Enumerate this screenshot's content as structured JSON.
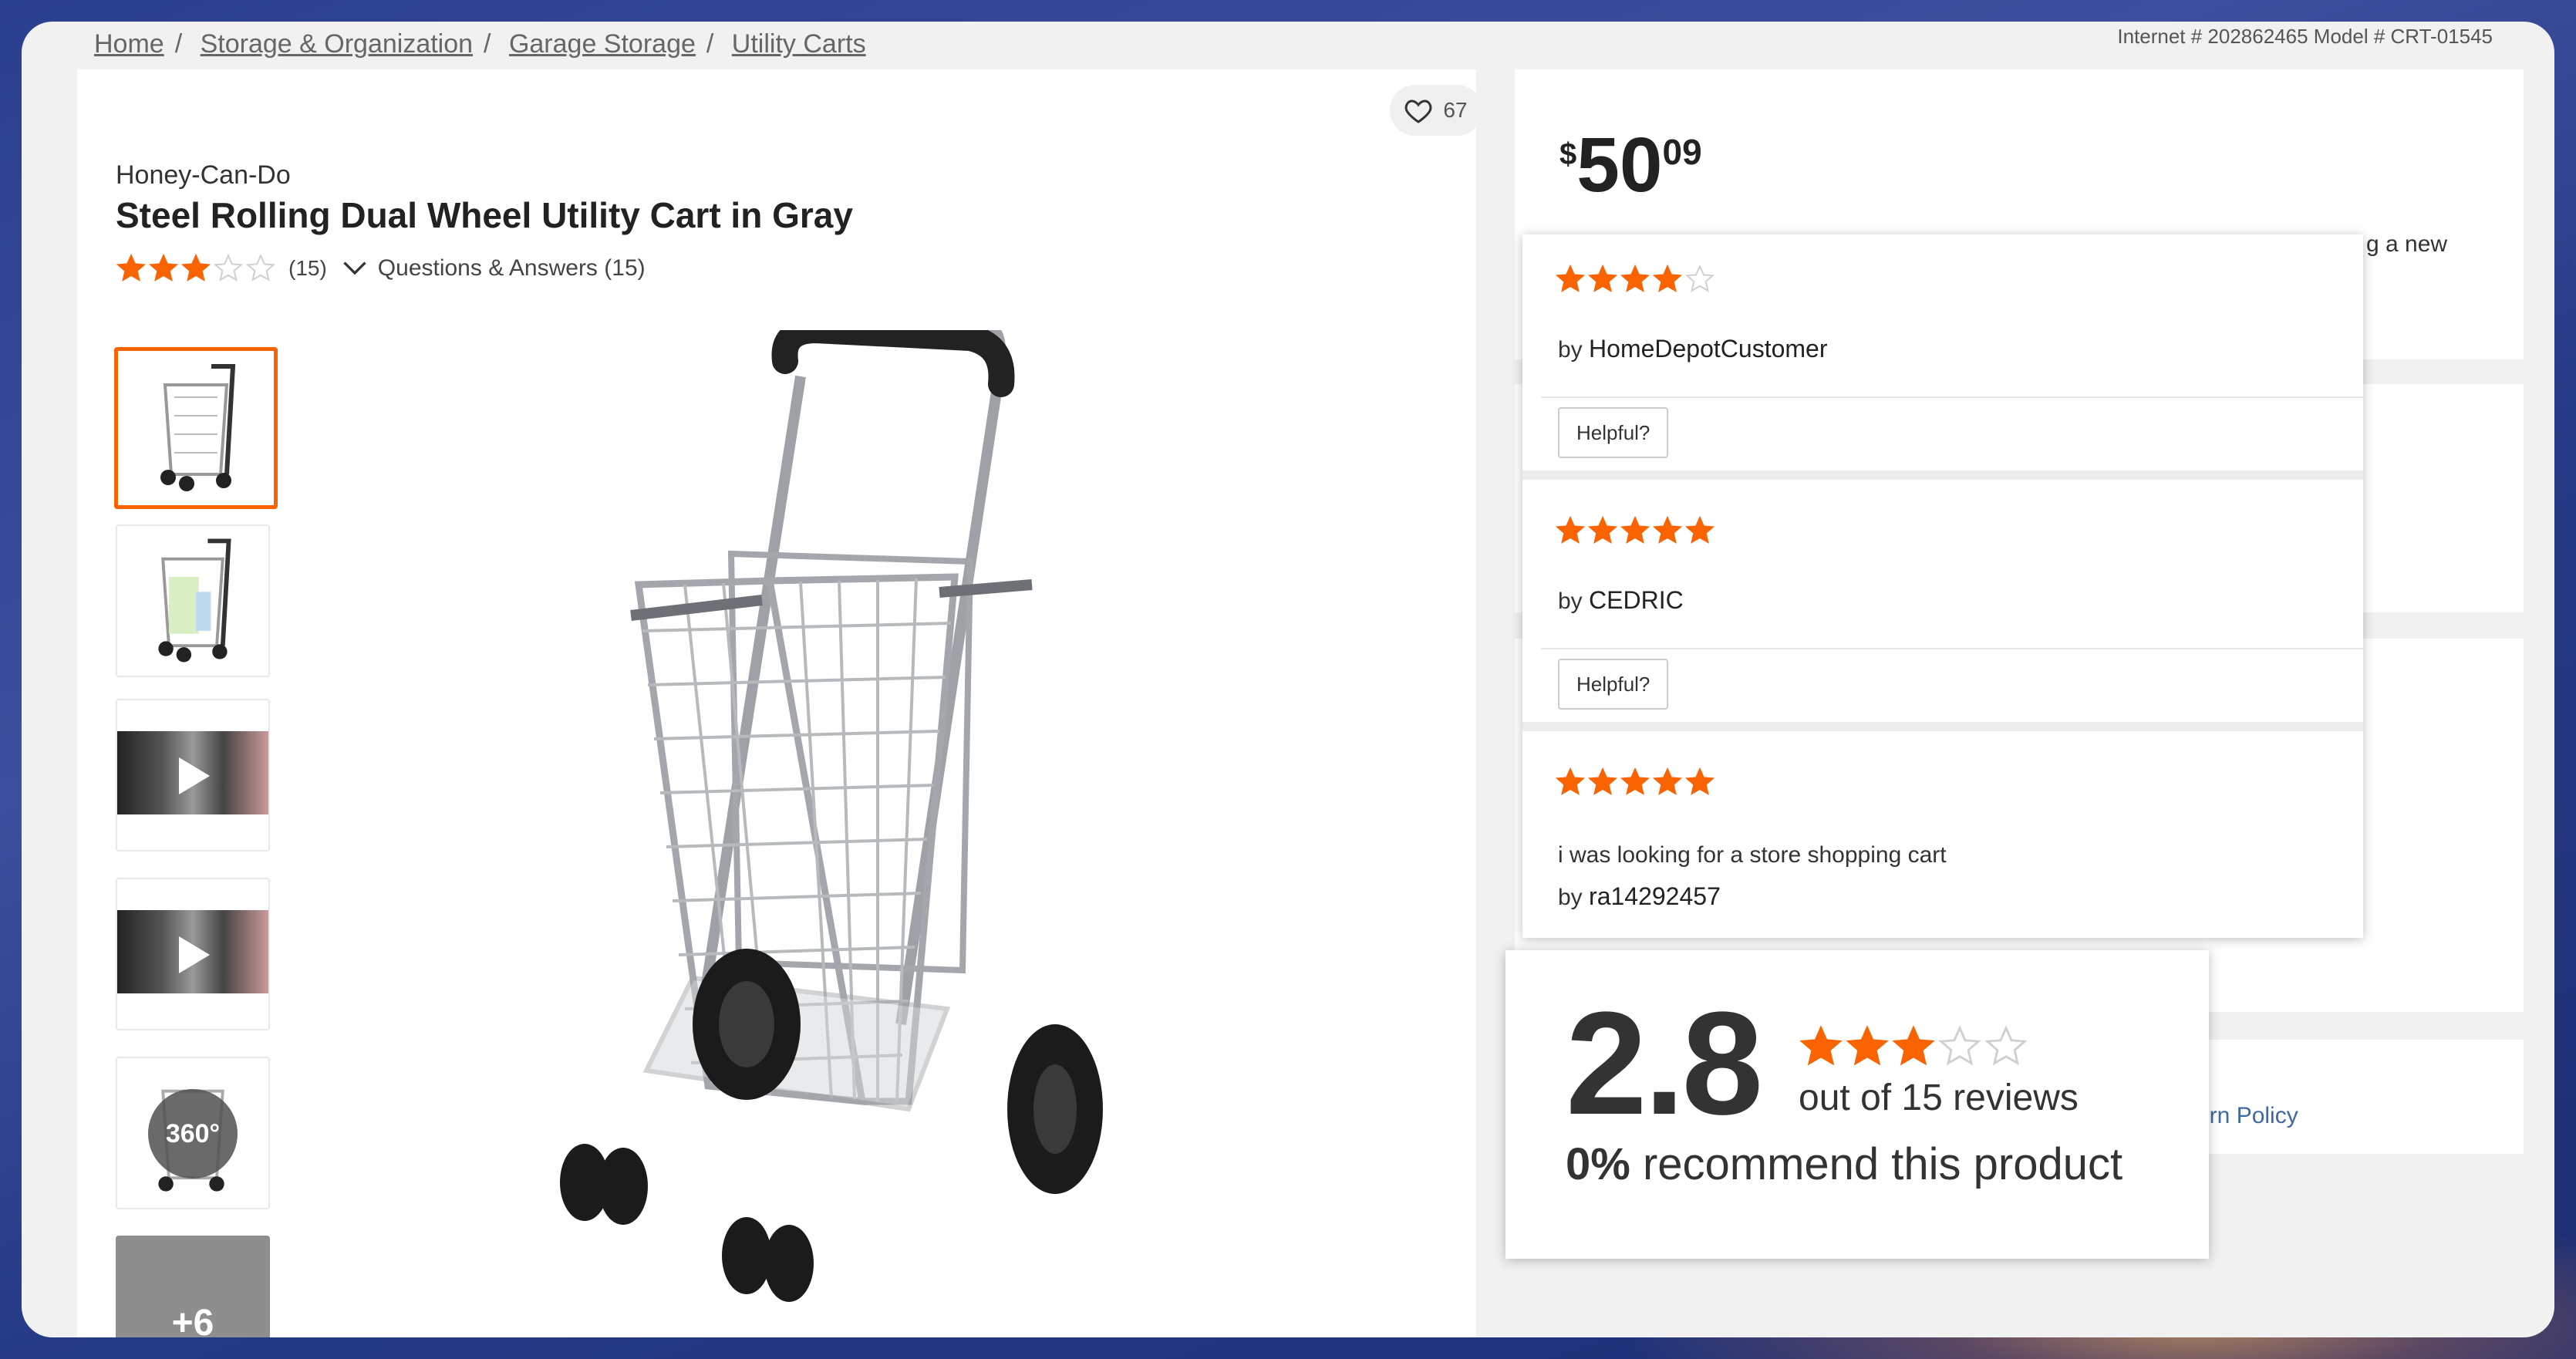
{
  "breadcrumb": [
    "Home",
    "Storage & Organization",
    "Garage Storage",
    "Utility Carts"
  ],
  "model_line": "Internet # 202862465  Model # CRT-01545",
  "product": {
    "favorites_count": "67",
    "brand": "Honey-Can-Do",
    "title": "Steel Rolling Dual Wheel Utility Cart in Gray",
    "rating": 2.8,
    "rating_count_label": "(15)",
    "qa_label": "Questions & Answers (15)"
  },
  "thumbnails": [
    {
      "type": "image",
      "label": "cart-front"
    },
    {
      "type": "image",
      "label": "cart-loaded"
    },
    {
      "type": "video",
      "label": "video-1"
    },
    {
      "type": "video",
      "label": "video-2"
    },
    {
      "type": "spin",
      "label": "360°"
    },
    {
      "type": "more",
      "label": "+6"
    }
  ],
  "price": {
    "currency": "$",
    "dollars": "50",
    "cents": "09"
  },
  "promo_tail": "g a new",
  "return_policy_tail": "urn Policy",
  "reviews": [
    {
      "stars": 4,
      "author_prefix": "by",
      "author": "HomeDepotCustomer",
      "text": "",
      "helpful_label": "Helpful?"
    },
    {
      "stars": 5,
      "author_prefix": "by",
      "author": "CEDRIC",
      "text": "",
      "helpful_label": "Helpful?"
    },
    {
      "stars": 5,
      "author_prefix": "by",
      "author": "ra14292457",
      "text": "i was looking for a store shopping cart",
      "helpful_label": ""
    }
  ],
  "summary": {
    "average": "2.8",
    "stars": 2.8,
    "out_of_label": "out of 15 reviews",
    "recommend_pct": "0%",
    "recommend_label": " recommend this product"
  },
  "colors": {
    "accent": "#f96302",
    "empty_star": "#d0d0d0",
    "link": "#3e6aa3"
  }
}
